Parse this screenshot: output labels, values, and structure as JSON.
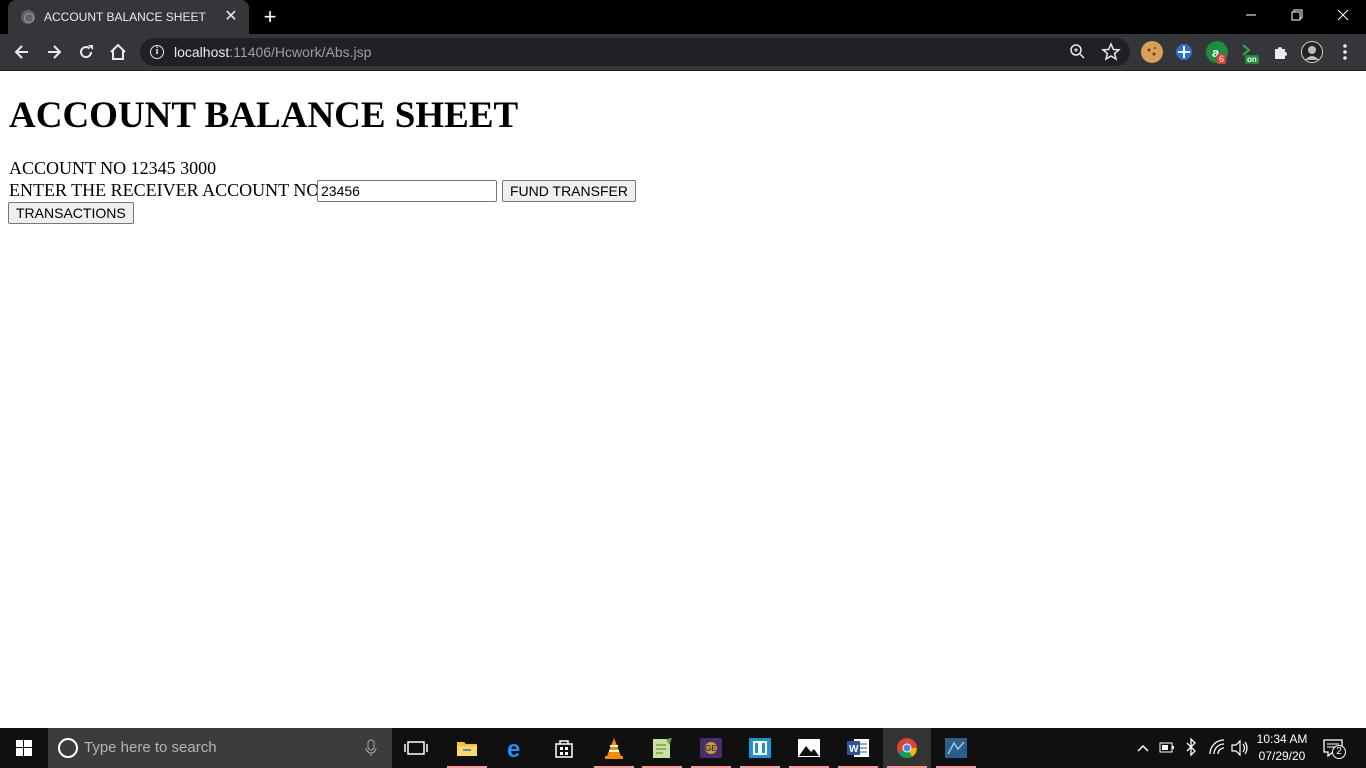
{
  "browser": {
    "tab_title": "ACCOUNT BALANCE SHEET",
    "close_tab": "✕",
    "new_tab": "+",
    "url_host": "localhost",
    "url_rest": ":11406/Hcwork/Abs.jsp",
    "window_controls": {
      "minimize": "—",
      "restore": "❐",
      "close": "✕"
    },
    "extension_badges": {
      "badge_6": "6",
      "badge_on": "on"
    }
  },
  "page": {
    "heading": "ACCOUNT BALANCE SHEET",
    "account_line": "ACCOUNT NO 12345 3000",
    "receiver_label": "ENTER THE RECEIVER ACCOUNT NO",
    "receiver_value": "23456",
    "fund_transfer_label": "FUND TRANSFER",
    "transactions_label": "TRANSACTIONS"
  },
  "taskbar": {
    "search_placeholder": "Type here to search",
    "time": "10:34 AM",
    "date": "07/29/20",
    "notification_count": "2",
    "pinned_apps": [
      "task-view",
      "file-explorer",
      "edge",
      "store",
      "vlc",
      "notepad-plus",
      "game-app",
      "cinema-app",
      "photos",
      "word",
      "chrome",
      "mysql-workbench"
    ]
  }
}
